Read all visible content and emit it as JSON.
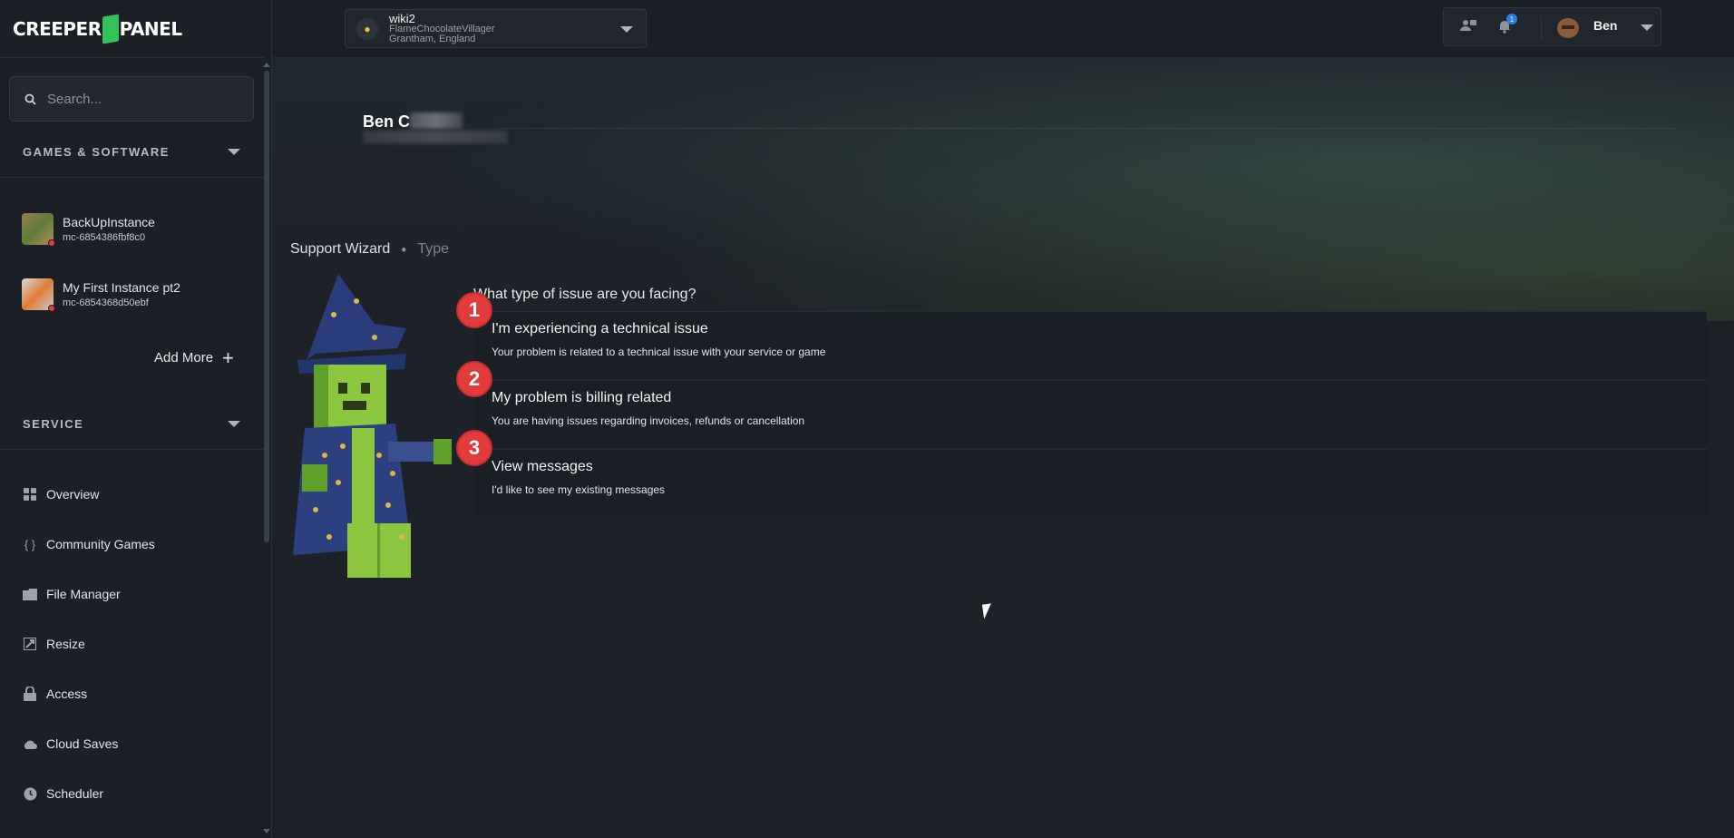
{
  "app": {
    "logo_text_left": "CREEPER",
    "logo_text_right": "PANEL"
  },
  "search": {
    "placeholder": "Search..."
  },
  "sidebar": {
    "games_section": "GAMES & SOFTWARE",
    "instances": [
      {
        "name": "BackUpInstance",
        "id": "mc-6854386fbf8c0"
      },
      {
        "name": "My First Instance pt2",
        "id": "mc-6854368d50ebf"
      }
    ],
    "add_more": "Add More",
    "service_section": "SERVICE",
    "nav": [
      {
        "label": "Overview",
        "icon": "grid-icon"
      },
      {
        "label": "Community Games",
        "icon": "braces-icon"
      },
      {
        "label": "File Manager",
        "icon": "folder-icon"
      },
      {
        "label": "Resize",
        "icon": "resize-icon"
      },
      {
        "label": "Access",
        "icon": "lock-icon"
      },
      {
        "label": "Cloud Saves",
        "icon": "cloud-icon"
      },
      {
        "label": "Scheduler",
        "icon": "clock-icon"
      }
    ]
  },
  "server": {
    "name": "wiki2",
    "player": "FlameChocolateVillager",
    "location": "Grantham, England"
  },
  "user": {
    "name": "Ben",
    "notifications": "1"
  },
  "profile": {
    "name_visible": "Ben C"
  },
  "breadcrumb": {
    "step1": "Support Wizard",
    "step2": "Type"
  },
  "wizard": {
    "question": "What type of issue are you facing?",
    "options": [
      {
        "num": "1",
        "title": "I'm experiencing a technical issue",
        "desc": "Your problem is related to a technical issue with your service or game"
      },
      {
        "num": "2",
        "title": "My problem is billing related",
        "desc": "You are having issues regarding invoices, refunds or cancellation"
      },
      {
        "num": "3",
        "title": "View messages",
        "desc": "I'd like to see my existing messages"
      }
    ]
  },
  "colors": {
    "accent_green": "#33c15a",
    "number_badge_red": "#e23b3b",
    "notification_blue": "#2d7de0"
  }
}
